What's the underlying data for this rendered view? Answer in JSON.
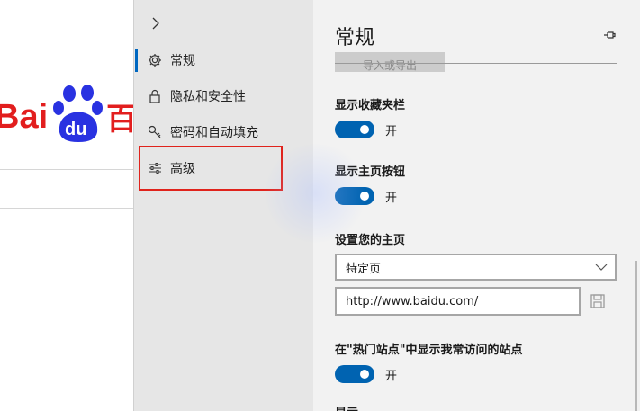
{
  "browser_page": {
    "logo_text": "Bai",
    "logo_paw_text": "du",
    "logo_cut_char": "百",
    "logo_colors": {
      "red": "#e21e1e",
      "blue": "#2932e1"
    }
  },
  "nav": {
    "back_icon": "chevron-right-icon",
    "items": [
      {
        "label": "常规",
        "icon": "gear-icon",
        "active": true
      },
      {
        "label": "隐私和安全性",
        "icon": "lock-icon",
        "active": false
      },
      {
        "label": "密码和自动填充",
        "icon": "key-icon",
        "active": false
      },
      {
        "label": "高级",
        "icon": "sliders-icon",
        "active": false
      }
    ],
    "accent": "#0067c0",
    "highlight_color": "#e0231c"
  },
  "content": {
    "title": "常规",
    "pin_icon": "pin-icon",
    "top_button_label": "导入或导出",
    "favorites_bar": {
      "label": "显示收藏夹栏",
      "state": "开",
      "on": true
    },
    "home_button": {
      "label": "显示主页按钮",
      "state": "开",
      "on": true
    },
    "homepage": {
      "label": "设置您的主页",
      "select_value": "特定页",
      "url_value": "http://www.baidu.com/"
    },
    "top_sites": {
      "label": "在\"热门站点\"中显示我常访问的站点",
      "state": "开",
      "on": true
    },
    "bottom_cut_label": "显示..."
  },
  "colors": {
    "toggle_on": "#0063b1",
    "nav_bg": "#e6e6e6",
    "content_bg": "#f2f2f2"
  }
}
